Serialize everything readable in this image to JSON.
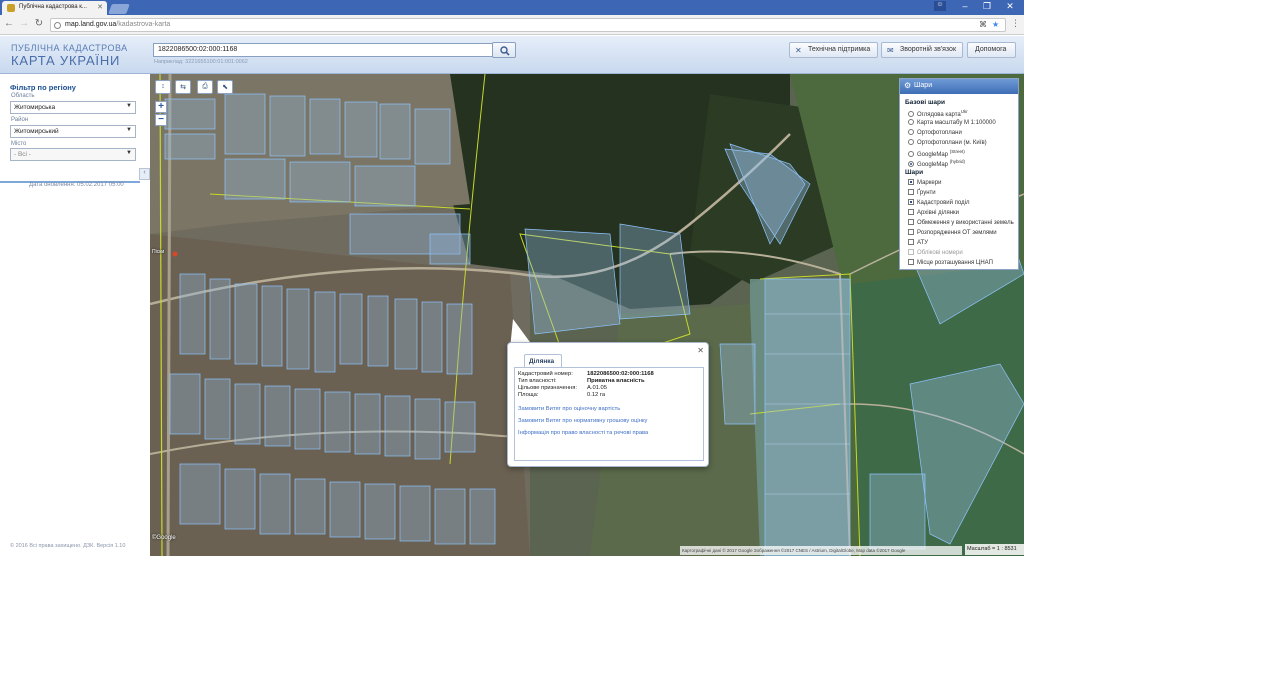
{
  "browser": {
    "tab_title": "Публічна кадастрова к...",
    "url_host": "map.land.gov.ua",
    "url_path": "/kadastrova-karta",
    "colors": {
      "tabstrip": "#3d67b5",
      "accent": "#2d59a3"
    }
  },
  "header": {
    "logo_line1": "ПУБЛІЧНА КАДАСТРОВА",
    "logo_line2": "КАРТА УКРАЇНИ",
    "search_value": "1822086500:02:000:1168",
    "search_hint": "Наприклад: 3221655100:01:001:0062",
    "buttons": [
      "Технічна підтримка",
      "Зворотній зв'язок",
      "Допомога"
    ]
  },
  "sidebar": {
    "filter_title": "Фільтр по регіону",
    "oblast_label": "Область",
    "oblast_value": "Житомирська",
    "raion_label": "Район",
    "raion_value": "Житомирський",
    "misto_label": "Місто",
    "misto_value": "- Всі -",
    "updated": "Дата оновлення: 05.02.2017 05:00",
    "copyright": "© 2016 Всі права захищено. ДЗК. Версія 1.10"
  },
  "layers": {
    "title": "Шари",
    "base_title": "Базові шари",
    "base_items": [
      {
        "label": "Оглядова карта",
        "sup": "Ukr",
        "checked": false
      },
      {
        "label": "Карта масштабу М 1:100000",
        "sup": "",
        "checked": false
      },
      {
        "label": "Ортофотоплани",
        "sup": "",
        "checked": false
      },
      {
        "label": "Ортофотоплани (м. Київ)",
        "sup": "",
        "checked": false
      },
      {
        "label": "GoogleMap",
        "sup": "(Street)",
        "checked": false
      },
      {
        "label": "GoogleMap",
        "sup": "(hybrid)",
        "checked": true
      }
    ],
    "overlay_title": "Шари",
    "overlay_items": [
      {
        "label": "Маркери",
        "checked": true,
        "dim": false
      },
      {
        "label": "Ґрунти",
        "checked": false,
        "dim": false
      },
      {
        "label": "Кадастровий поділ",
        "checked": true,
        "dim": false
      },
      {
        "label": "Архівні ділянки",
        "checked": false,
        "dim": false
      },
      {
        "label": "Обмеження у використанні земель",
        "checked": false,
        "dim": false
      },
      {
        "label": "Розпорядження ОТ землями",
        "checked": false,
        "dim": false
      },
      {
        "label": "АТУ",
        "checked": false,
        "dim": false
      },
      {
        "label": "Облікові номери",
        "checked": false,
        "dim": true
      },
      {
        "label": "Місце розташування ЦНАП",
        "checked": false,
        "dim": false
      }
    ]
  },
  "popup": {
    "tab": "Ділянка",
    "rows": [
      {
        "label": "Кадастровий номер:",
        "value": "1822086500:02:000:1168"
      },
      {
        "label": "Тип власності:",
        "value": "Приватна власність"
      },
      {
        "label": "Цільове призначення:",
        "value": "А.01.05"
      },
      {
        "label": "Площа:",
        "value": "0.12 га"
      }
    ],
    "links": [
      "Замовити Витяг про оціночну вартість",
      "Замовити Витяг про нормативну грошову оцінку",
      "Інформація про право власності та речові права"
    ]
  },
  "map": {
    "attribution": "Картографічні дані © 2017 Google Зображення ©2017 CNES / Astrium, DigitalGlobe, Map data ©2017 Google",
    "scale": "Масштаб = 1 : 8531",
    "google_mark": "©Google",
    "labels": [
      "Піски"
    ],
    "tools": [
      "↕",
      "⇆",
      "⎙",
      "⬉"
    ]
  }
}
